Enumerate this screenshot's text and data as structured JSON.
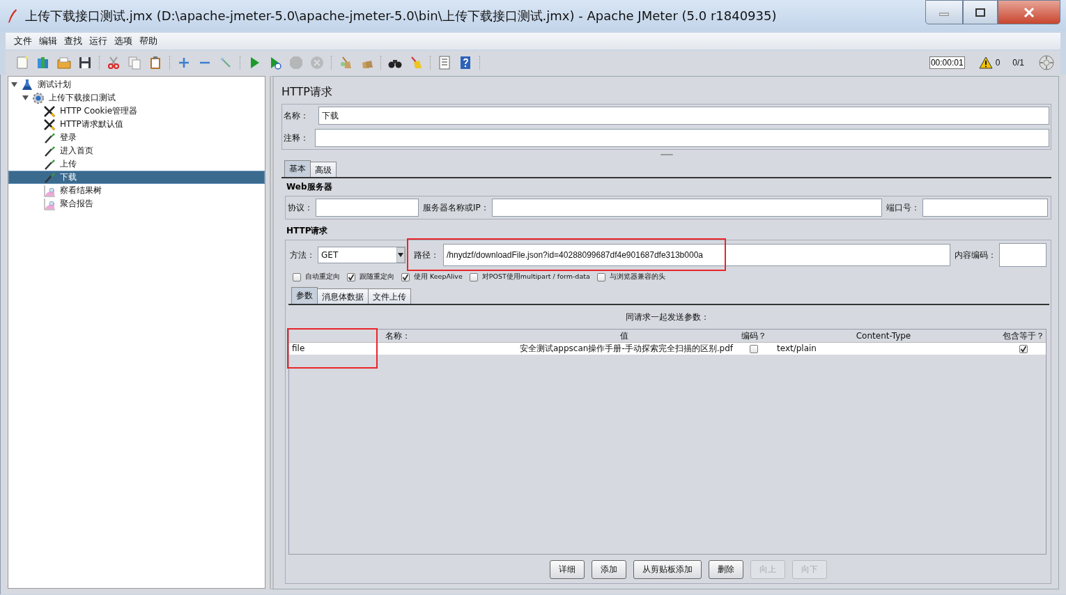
{
  "window": {
    "title": "上传下载接口测试.jmx (D:\\apache-jmeter-5.0\\apache-jmeter-5.0\\bin\\上传下载接口测试.jmx) - Apache JMeter (5.0 r1840935)"
  },
  "menu": [
    "文件",
    "编辑",
    "查找",
    "运行",
    "选项",
    "帮助"
  ],
  "toolbar": {
    "groups": [
      [
        {
          "kind": "new",
          "disabled": false
        },
        {
          "kind": "templates",
          "disabled": false
        },
        {
          "kind": "open",
          "disabled": false
        },
        {
          "kind": "save",
          "disabled": false
        }
      ],
      [
        {
          "kind": "cut",
          "disabled": false
        },
        {
          "kind": "copy",
          "disabled": false
        },
        {
          "kind": "paste",
          "disabled": false
        }
      ],
      [
        {
          "kind": "expand",
          "disabled": false
        },
        {
          "kind": "collapse",
          "disabled": false
        },
        {
          "kind": "toggle",
          "disabled": false
        }
      ],
      [
        {
          "kind": "start",
          "disabled": false
        },
        {
          "kind": "start-no-timers",
          "disabled": false
        },
        {
          "kind": "stop",
          "disabled": true
        },
        {
          "kind": "shutdown",
          "disabled": true
        }
      ],
      [
        {
          "kind": "clear",
          "disabled": false
        },
        {
          "kind": "clear-all",
          "disabled": false
        }
      ],
      [
        {
          "kind": "search",
          "disabled": false
        },
        {
          "kind": "reset-search",
          "disabled": false
        }
      ],
      [
        {
          "kind": "functions",
          "disabled": false
        },
        {
          "kind": "help",
          "disabled": false
        }
      ]
    ],
    "timer": "00:00:01",
    "warnings": "0",
    "threads": "0/1"
  },
  "tree": [
    {
      "label": "测试计划",
      "kind": "plan",
      "expanded": true,
      "selected": false,
      "children": [
        {
          "label": "上传下载接口测试",
          "kind": "thread-group",
          "expanded": true,
          "selected": false,
          "children": [
            {
              "label": "HTTP Cookie管理器",
              "kind": "config",
              "selected": false
            },
            {
              "label": "HTTP请求默认值",
              "kind": "config",
              "selected": false
            },
            {
              "label": "登录",
              "kind": "sampler",
              "selected": false
            },
            {
              "label": "进入首页",
              "kind": "sampler",
              "selected": false
            },
            {
              "label": "上传",
              "kind": "sampler",
              "selected": false
            },
            {
              "label": "下载",
              "kind": "sampler",
              "selected": true
            },
            {
              "label": "察看结果树",
              "kind": "listener",
              "selected": false
            },
            {
              "label": "聚合报告",
              "kind": "listener",
              "selected": false
            }
          ]
        }
      ]
    }
  ],
  "panel": {
    "title": "HTTP请求",
    "name": {
      "label": "名称：",
      "value": "下载"
    },
    "comment": {
      "label": "注释："
    },
    "tabs": [
      {
        "label": "基本",
        "selected": true
      },
      {
        "label": "高级",
        "selected": false
      }
    ],
    "web_server": {
      "heading": "Web服务器",
      "protocol": {
        "label": "协议："
      },
      "server": {
        "label": "服务器名称或IP："
      },
      "port": {
        "label": "端口号："
      }
    },
    "http_request": {
      "heading": "HTTP请求",
      "method": {
        "label": "方法：",
        "value": "GET"
      },
      "path": {
        "label": "路径：",
        "value": "/hnydzf/downloadFile.json?id=40288099687df4e901687dfe313b000a",
        "highlighted": true
      },
      "encoding": {
        "label": "内容编码："
      },
      "options": [
        {
          "label": "自动重定向",
          "checked": false
        },
        {
          "label": "跟随重定向",
          "checked": true
        },
        {
          "label": "使用 KeepAlive",
          "checked": true
        },
        {
          "label": "对POST使用multipart / form-data",
          "checked": false
        },
        {
          "label": "与浏览器兼容的头",
          "checked": false
        }
      ],
      "tabs": [
        {
          "label": "参数",
          "selected": true
        },
        {
          "label": "消息体数据",
          "selected": false
        },
        {
          "label": "文件上传",
          "selected": false
        }
      ],
      "params": {
        "caption": "同请求一起发送参数：",
        "columns": [
          "名称：",
          "值",
          "编码？",
          "Content-Type",
          "包含等于？"
        ],
        "rows": [
          {
            "name": "file",
            "value": "安全测试appscan操作手册-手动探索完全扫描的区别.pdf",
            "encode": false,
            "content_type": "text/plain",
            "include_equals": true,
            "highlighted": true
          }
        ]
      }
    },
    "buttons": [
      {
        "label": "详细",
        "disabled": false
      },
      {
        "label": "添加",
        "disabled": false
      },
      {
        "label": "从剪贴板添加",
        "disabled": false
      },
      {
        "label": "删除",
        "disabled": false
      },
      {
        "label": "向上",
        "disabled": true
      },
      {
        "label": "向下",
        "disabled": true
      }
    ]
  }
}
